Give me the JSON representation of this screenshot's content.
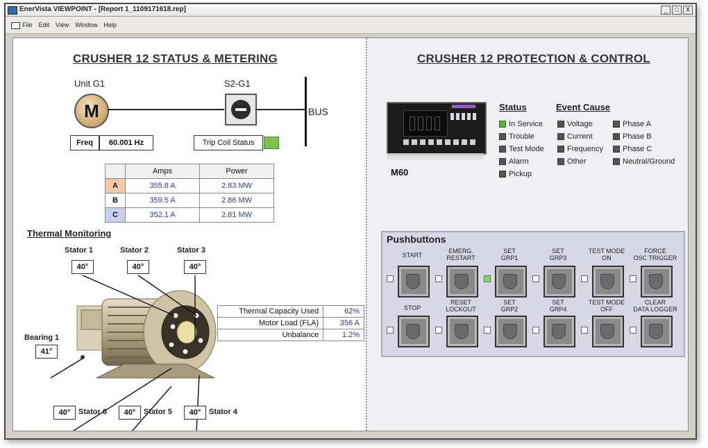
{
  "window": {
    "title": "EnerVista VIEWPOINT - [Report 1_1109171618.rep]",
    "controls": [
      "_",
      "□",
      "X"
    ]
  },
  "menu": [
    "File",
    "Edit",
    "View",
    "Window",
    "Help"
  ],
  "left": {
    "title": "CRUSHER 12 STATUS & METERING",
    "unit_label": "Unit G1",
    "motor_symbol": "M",
    "breaker_label": "S2-G1",
    "bus_label": "BUS",
    "freq_label": "Freq",
    "freq_value": "60.001 Hz",
    "trip_coil_label": "Trip Coil Status",
    "trip_coil_color": "#7dc24f",
    "meter": {
      "headers": [
        "",
        "Amps",
        "Power"
      ],
      "rows": [
        {
          "phase": "A",
          "amps": "355.8 A",
          "power": "2.83 MW",
          "color": "#f4c9a8"
        },
        {
          "phase": "B",
          "amps": "359.5 A",
          "power": "2.86 MW",
          "color": "#ffffff"
        },
        {
          "phase": "C",
          "amps": "352.1 A",
          "power": "2.81 MW",
          "color": "#c9d0ee"
        }
      ]
    },
    "thermal_title": "Thermal Monitoring",
    "stators": {
      "s1": {
        "label": "Stator 1",
        "value": "40°"
      },
      "s2": {
        "label": "Stator 2",
        "value": "40°"
      },
      "s3": {
        "label": "Stator 3",
        "value": "40°"
      },
      "s4": {
        "label": "Stator 4",
        "value": "40°"
      },
      "s5": {
        "label": "Stator 5",
        "value": "40°"
      },
      "s6": {
        "label": "Stator 6",
        "value": "40°"
      },
      "b1": {
        "label": "Bearing 1",
        "value": "41°"
      }
    },
    "thermal_table": [
      {
        "label": "Thermal Capacity Used",
        "value": "62%"
      },
      {
        "label": "Motor Load (FLA)",
        "value": "356 A"
      },
      {
        "label": "Unbalance",
        "value": "1.2%"
      }
    ]
  },
  "right": {
    "title": "CRUSHER 12 PROTECTION & CONTROL",
    "device_label": "M60",
    "status_title": "Status",
    "status_items": [
      {
        "label": "In Service",
        "on": true
      },
      {
        "label": "Trouble",
        "on": false
      },
      {
        "label": "Test Mode",
        "on": false
      },
      {
        "label": "Alarm",
        "on": false
      },
      {
        "label": "Pickup",
        "on": false
      }
    ],
    "event_title": "Event Cause",
    "event_col1": [
      "Voltage",
      "Current",
      "Frequency",
      "Other"
    ],
    "event_col2": [
      "Phase A",
      "Phase B",
      "Phase C",
      "Neutral/Ground"
    ],
    "pushbuttons_title": "Pushbuttons",
    "pushbuttons": [
      {
        "label": "START",
        "led_on": false
      },
      {
        "label": "EMERG.\nRESTART",
        "led_on": false
      },
      {
        "label": "SET\nGRP1",
        "led_on": true
      },
      {
        "label": "SET\nGRP3",
        "led_on": false
      },
      {
        "label": "TEST MODE\nON",
        "led_on": false
      },
      {
        "label": "FORCE\nOSC TRIGGER",
        "led_on": false
      },
      {
        "label": "STOP",
        "led_on": false
      },
      {
        "label": "RESET\nLOCKOUT",
        "led_on": false
      },
      {
        "label": "SET\nGRP2",
        "led_on": false
      },
      {
        "label": "SET\nGRP4",
        "led_on": false
      },
      {
        "label": "TEST MODE\nOFF",
        "led_on": false
      },
      {
        "label": "CLEAR\nDATA LOGGER",
        "led_on": false
      }
    ]
  }
}
